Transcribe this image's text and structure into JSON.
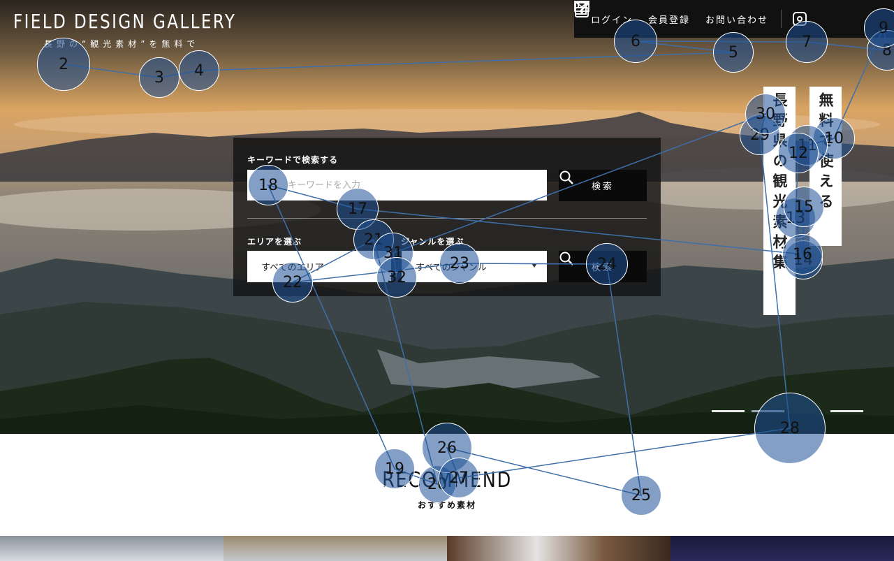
{
  "header": {
    "logo": "FIELD DESIGN GALLERY",
    "tagline": "長野の“観光素材”を無料で",
    "nav": [
      {
        "label": "ログイン",
        "icon": "lock-icon"
      },
      {
        "label": "会員登録",
        "icon": "edit-icon"
      },
      {
        "label": "お問い合わせ",
        "icon": "mail-icon"
      }
    ],
    "social_icon": "instagram-icon"
  },
  "hero": {
    "vertical_text_1": "無料で使える",
    "vertical_text_2": "長野県の観光素材集"
  },
  "search": {
    "keyword_label": "キーワードで検索する",
    "keyword_placeholder": "キーワードを入力",
    "keyword_button": "検索",
    "area_label": "エリアを選ぶ",
    "area_value": "すべてのエリア",
    "genre_label": "ジャンルを選ぶ",
    "genre_value": "すべてのジャンル",
    "filter_button": "検索"
  },
  "recommend": {
    "title": "RECOMMEND",
    "subtitle": "おすすめ素材"
  },
  "colors": {
    "nav_bg": "#111111",
    "panel_bg": "#141414",
    "gaze_fill": "#1e5096"
  },
  "gaze_points": [
    {
      "n": "2"
    },
    {
      "n": "3"
    },
    {
      "n": "4"
    },
    {
      "n": "5"
    },
    {
      "n": "6"
    },
    {
      "n": "7"
    },
    {
      "n": "8"
    },
    {
      "n": "9"
    },
    {
      "n": "10"
    },
    {
      "n": "11"
    },
    {
      "n": "12"
    },
    {
      "n": "13"
    },
    {
      "n": "14"
    },
    {
      "n": "15"
    },
    {
      "n": "16"
    },
    {
      "n": "17"
    },
    {
      "n": "18"
    },
    {
      "n": "19"
    },
    {
      "n": "20"
    },
    {
      "n": "21"
    },
    {
      "n": "22"
    },
    {
      "n": "23"
    },
    {
      "n": "24"
    },
    {
      "n": "25"
    },
    {
      "n": "26"
    },
    {
      "n": "27"
    },
    {
      "n": "28"
    },
    {
      "n": "29"
    },
    {
      "n": "30"
    },
    {
      "n": "31"
    },
    {
      "n": "32"
    }
  ]
}
